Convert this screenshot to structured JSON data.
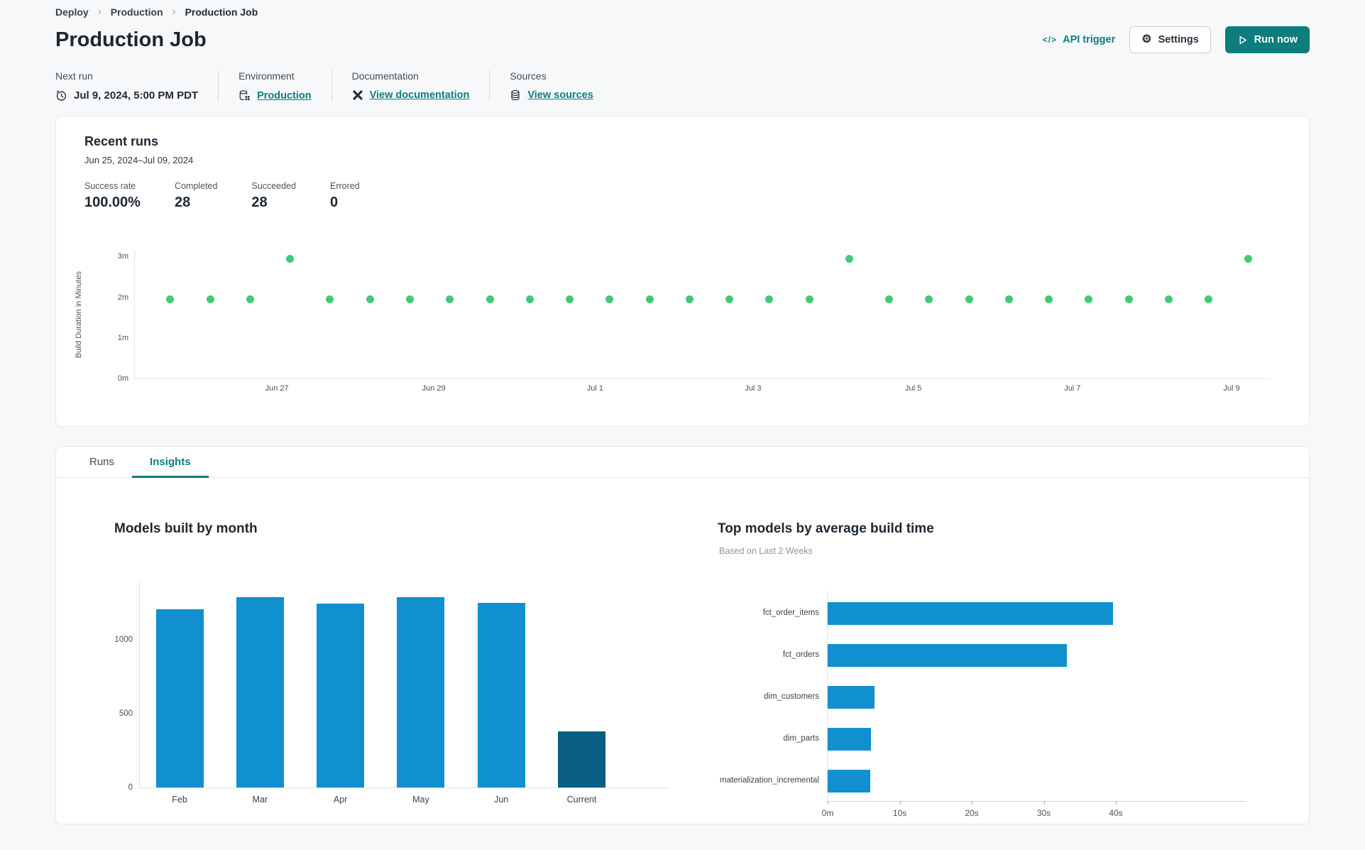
{
  "breadcrumb": {
    "items": [
      "Deploy",
      "Production",
      "Production Job"
    ]
  },
  "header": {
    "title": "Production Job",
    "api_trigger_label": "API trigger",
    "settings_label": "Settings",
    "run_now_label": "Run now"
  },
  "icons": {
    "api_trigger": "</>",
    "gear": "⚙",
    "breadcrumb_separator": "›"
  },
  "meta": {
    "next_run": {
      "label": "Next run",
      "value": "Jul 9, 2024, 5:00 PM PDT"
    },
    "environment": {
      "label": "Environment",
      "link": "Production"
    },
    "documentation": {
      "label": "Documentation",
      "link": "View documentation"
    },
    "sources": {
      "label": "Sources",
      "link": "View sources"
    }
  },
  "recent_runs": {
    "title": "Recent runs",
    "date_range": "Jun 25, 2024–Jul 09, 2024",
    "stats": [
      {
        "label": "Success rate",
        "value": "100.00%"
      },
      {
        "label": "Completed",
        "value": "28"
      },
      {
        "label": "Succeeded",
        "value": "28"
      },
      {
        "label": "Errored",
        "value": "0"
      }
    ]
  },
  "tabs": [
    {
      "label": "Runs",
      "active": false
    },
    {
      "label": "Insights",
      "active": true
    }
  ],
  "colors": {
    "accent_teal": "#0E7D7D",
    "dot_green": "#41CA73",
    "bar_blue": "#1090CE",
    "bar_dark_blue": "#0A5D83"
  },
  "chart_data": [
    {
      "id": "build_duration",
      "type": "scatter",
      "ylabel": "Build Duration in Minutes",
      "ylim": [
        0,
        3.18
      ],
      "yticks": [
        {
          "label": "0m",
          "value": 0
        },
        {
          "label": "1m",
          "value": 1
        },
        {
          "label": "2m",
          "value": 2
        },
        {
          "label": "3m",
          "value": 3
        }
      ],
      "xticks": [
        {
          "label": "Jun 27",
          "frac": 0.125
        },
        {
          "label": "Jun 29",
          "frac": 0.263
        },
        {
          "label": "Jul 1",
          "frac": 0.405
        },
        {
          "label": "Jul 3",
          "frac": 0.544
        },
        {
          "label": "Jul 5",
          "frac": 0.685
        },
        {
          "label": "Jul 7",
          "frac": 0.825
        },
        {
          "label": "Jul 9",
          "frac": 0.965
        }
      ],
      "values": [
        1.95,
        1.95,
        1.95,
        2.95,
        1.95,
        1.95,
        1.95,
        1.95,
        1.95,
        1.95,
        1.95,
        1.95,
        1.95,
        1.95,
        1.95,
        1.95,
        1.95,
        2.95,
        1.95,
        1.95,
        1.95,
        1.95,
        1.95,
        1.95,
        1.95,
        1.95,
        1.95,
        2.95
      ],
      "point_color": "#41CA73"
    },
    {
      "id": "models_by_month",
      "type": "bar",
      "title": "Models built by month",
      "categories": [
        "Feb",
        "Mar",
        "Apr",
        "May",
        "Jun",
        "Current"
      ],
      "values": [
        1210,
        1290,
        1245,
        1290,
        1250,
        380
      ],
      "bar_colors": [
        "#1090CE",
        "#1090CE",
        "#1090CE",
        "#1090CE",
        "#1090CE",
        "#0A5D83"
      ],
      "yticks": [
        0,
        500,
        1000
      ],
      "ylim": [
        0,
        1400
      ]
    },
    {
      "id": "top_models",
      "type": "bar-horizontal",
      "title": "Top models by average build time",
      "subtitle": "Based on Last 2 Weeks",
      "categories": [
        "fct_order_items",
        "fct_orders",
        "dim_customers",
        "dim_parts",
        "materialization_incremental"
      ],
      "values": [
        39.6,
        33.2,
        6.5,
        6.0,
        5.9
      ],
      "bar_color": "#1090CE",
      "xticks": [
        {
          "label": "0m",
          "value": 0
        },
        {
          "label": "10s",
          "value": 10
        },
        {
          "label": "20s",
          "value": 20
        },
        {
          "label": "30s",
          "value": 30
        },
        {
          "label": "40s",
          "value": 40
        }
      ],
      "xlim": [
        0,
        58
      ]
    }
  ]
}
